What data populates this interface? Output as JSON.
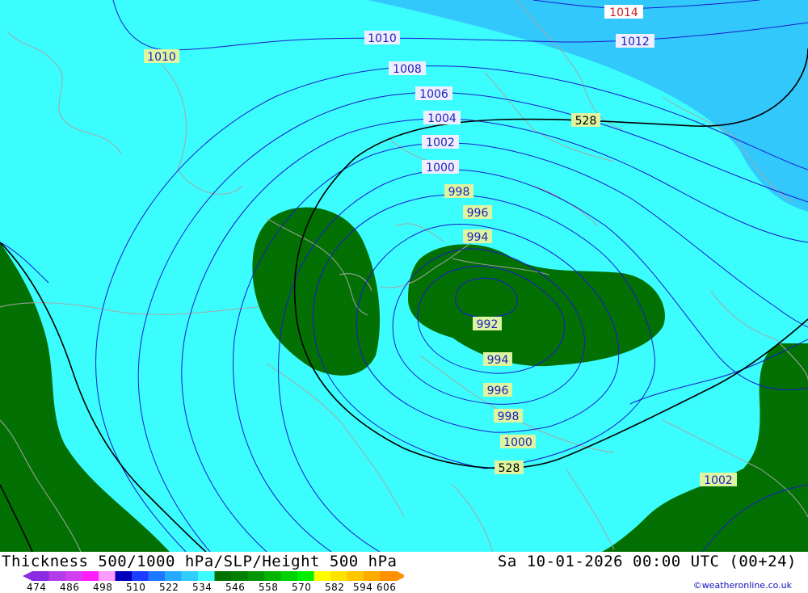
{
  "title": "Thickness 500/1000 hPa/SLP/Height 500 hPa",
  "valid_time": "Sa 10-01-2026 00:00 UTC (00+24)",
  "credit": "©weatheronline.co.uk",
  "colors": {
    "thickness_528_534": "#037003",
    "thickness_522_528": "#3cfdfd",
    "thickness_516_522": "#32c8fc",
    "isobar": "#1a1ad0",
    "height_500": "#000000",
    "coast": "#a6a6a6"
  },
  "legend": {
    "ticks": [
      "474",
      "486",
      "498",
      "510",
      "522",
      "534",
      "546",
      "558",
      "570",
      "582",
      "594",
      "606"
    ],
    "colors": [
      "#8a2be2",
      "#b23ce8",
      "#d040f0",
      "#ff1cff",
      "#ff9cff",
      "#0000bc",
      "#1e3cff",
      "#1e78ff",
      "#26aaff",
      "#32cdff",
      "#3cfdfd",
      "#037003",
      "#038003",
      "#049404",
      "#00b400",
      "#00d200",
      "#00f000",
      "#fffe00",
      "#ffe300",
      "#ffc700",
      "#ffab00",
      "#ff9000"
    ]
  },
  "isobar_labels": [
    {
      "text": "1014"
    },
    {
      "text": "1012"
    },
    {
      "text": "1010"
    },
    {
      "text": "1010"
    },
    {
      "text": "1008"
    },
    {
      "text": "1006"
    },
    {
      "text": "1004"
    },
    {
      "text": "1002"
    },
    {
      "text": "1000"
    },
    {
      "text": "998"
    },
    {
      "text": "996"
    },
    {
      "text": "994"
    },
    {
      "text": "992"
    },
    {
      "text": "994"
    },
    {
      "text": "996"
    },
    {
      "text": "998"
    },
    {
      "text": "1000"
    },
    {
      "text": "1002"
    }
  ],
  "height_labels": [
    {
      "text": "528"
    },
    {
      "text": "528"
    }
  ]
}
